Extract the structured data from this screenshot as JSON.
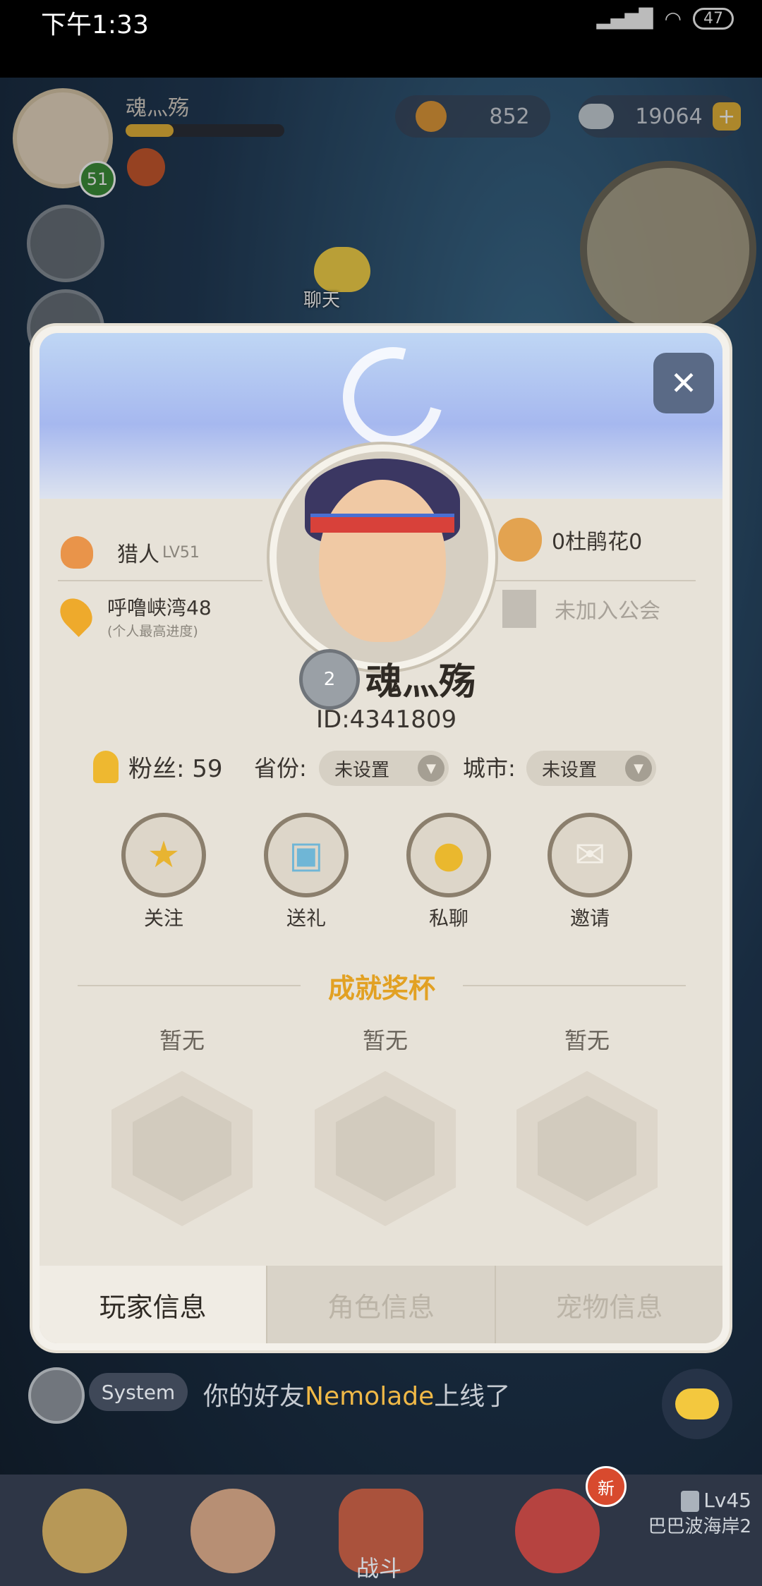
{
  "status_bar": {
    "time": "下午1:33",
    "battery": "47"
  },
  "hud": {
    "level": "51",
    "player_name": "魂灬殇",
    "currency_1": "852",
    "currency_2": "19064",
    "chat_label": "聊天"
  },
  "dialog": {
    "left_top": {
      "label": "猎人",
      "level": "LV51"
    },
    "left_bottom": {
      "label": "呼噜峡湾48",
      "sub": "(个人最高进度)"
    },
    "right_top": {
      "label": "0杜鹃花0"
    },
    "right_bottom": {
      "label": "未加入公会"
    },
    "rank": "2",
    "name": "魂灬殇",
    "id_text": "ID:4341809",
    "fans": "粉丝: 59",
    "province_label": "省份:",
    "province_value": "未设置",
    "city_label": "城市:",
    "city_value": "未设置",
    "actions": [
      {
        "label": "关注",
        "icon": "star-icon"
      },
      {
        "label": "送礼",
        "icon": "gift-icon"
      },
      {
        "label": "私聊",
        "icon": "chat-icon"
      },
      {
        "label": "邀请",
        "icon": "mail-icon"
      }
    ],
    "achievement_title": "成就奖杯",
    "trophies": [
      "暂无",
      "暂无",
      "暂无"
    ],
    "tabs": [
      "玩家信息",
      "角色信息",
      "宠物信息"
    ],
    "close_symbol": "✕"
  },
  "system_chat": {
    "tag": "System",
    "message_prefix": "你的好友",
    "friend": "Nemolade",
    "message_suffix": "上线了"
  },
  "bottom_nav": {
    "battle_label": "战斗",
    "new_badge": "新",
    "locked_level": "Lv45",
    "locked_name": "巴巴波海岸2"
  },
  "colors": {
    "accent": "#e2a123",
    "close_button": "#5a6a86",
    "new_badge": "#d84a2e"
  }
}
